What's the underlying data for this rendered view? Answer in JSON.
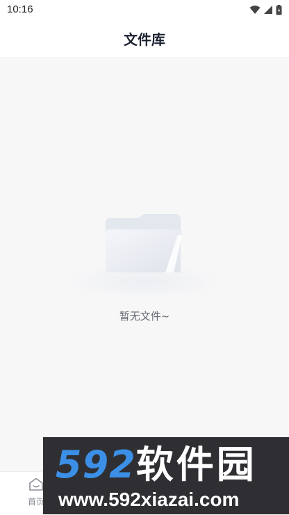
{
  "status_bar": {
    "time": "10:16"
  },
  "header": {
    "title": "文件库"
  },
  "empty_state": {
    "message": "暂无文件~",
    "icon": "folder-icon"
  },
  "bottom_nav": {
    "items": [
      {
        "label": "首页",
        "icon": "home-icon"
      }
    ]
  },
  "watermark": {
    "logo_text": "592",
    "logo_cn": "软件园",
    "url": "www.592xiazai.com"
  },
  "colors": {
    "title": "#1c2230",
    "background": "#f7f7f8",
    "watermark_blue": "#3b8fe6"
  }
}
